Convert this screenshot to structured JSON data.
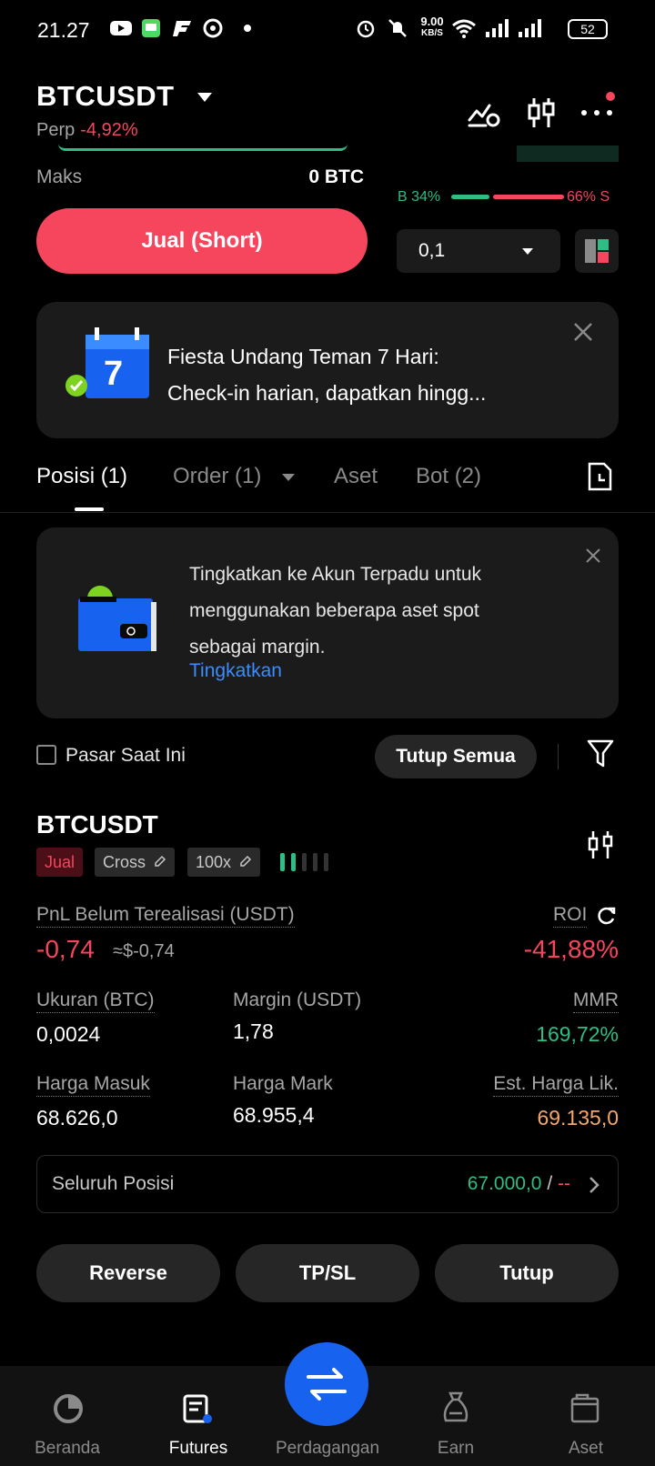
{
  "status_bar": {
    "time": "21.27",
    "net_speed_value": "9.00",
    "net_speed_unit": "KB/S",
    "battery": "52"
  },
  "header": {
    "pair": "BTCUSDT",
    "contract_type": "Perp",
    "change": "-4,92%"
  },
  "order_form": {
    "max_label": "Maks",
    "max_value": "0 BTC",
    "sell_button": "Jual (Short)"
  },
  "orderbook": {
    "buy_ratio": "B 34%",
    "sell_ratio": "66% S",
    "buy_ratio_fraction": 0.34,
    "precision": "0,1"
  },
  "promo": {
    "calendar_day": "7",
    "text_line1": "Fiesta Undang Teman 7 Hari:",
    "text_line2": "Check-in harian, dapatkan hingg..."
  },
  "tabs": [
    {
      "label": "Posisi (1)",
      "active": true
    },
    {
      "label": "Order (1)",
      "active": false
    },
    {
      "label": "Aset",
      "active": false
    },
    {
      "label": "Bot (2)",
      "active": false
    }
  ],
  "upgrade_card": {
    "text_line1": "Tingkatkan ke Akun Terpadu untuk",
    "text_line2": "menggunakan beberapa aset spot",
    "text_line3": "sebagai margin.",
    "link": "Tingkatkan"
  },
  "filters": {
    "current_market_label": "Pasar Saat Ini",
    "close_all": "Tutup Semua"
  },
  "position": {
    "symbol": "BTCUSDT",
    "side": "Jual",
    "margin_mode": "Cross",
    "leverage": "100x",
    "adl_level": 2,
    "pnl_label": "PnL Belum Terealisasi (USDT)",
    "pnl_value": "-0,74",
    "pnl_usd": "≈$-0,74",
    "roi_label": "ROI",
    "roi_value": "-41,88%",
    "size_label": "Ukuran (BTC)",
    "size_value": "0,0024",
    "margin_label": "Margin (USDT)",
    "margin_value": "1,78",
    "mmr_label": "MMR",
    "mmr_value": "169,72%",
    "entry_label": "Harga Masuk",
    "entry_value": "68.626,0",
    "mark_label": "Harga Mark",
    "mark_value": "68.955,4",
    "liq_label": "Est. Harga Lik.",
    "liq_value": "69.135,0",
    "all_positions_label": "Seluruh Posisi",
    "all_positions_price": "67.000,0",
    "all_positions_sep": " / ",
    "all_positions_extra": "--"
  },
  "actions": {
    "reverse": "Reverse",
    "tpsl": "TP/SL",
    "close": "Tutup"
  },
  "bottom_nav": [
    {
      "label": "Beranda",
      "active": false
    },
    {
      "label": "Futures",
      "active": true
    },
    {
      "label": "Perdagangan",
      "active": false
    },
    {
      "label": "Earn",
      "active": false
    },
    {
      "label": "Aset",
      "active": false
    }
  ],
  "colors": {
    "sell": "#f6465d",
    "buy": "#2ebd85",
    "liq": "#f5a66b",
    "link": "#3a8cff",
    "fab": "#1763f0"
  }
}
